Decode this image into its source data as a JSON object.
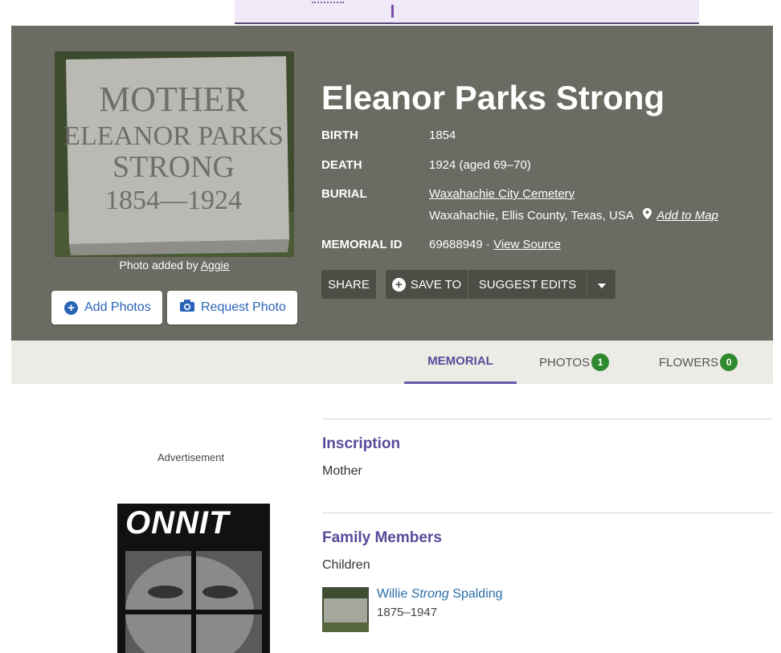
{
  "memorial": {
    "name": "Eleanor Parks Strong",
    "photo_credit_prefix": "Photo added by",
    "photo_credit_user": "Aggie",
    "headstone_lines": [
      "MOTHER",
      "ELEANOR PARKS",
      "STRONG",
      "1854—1924"
    ],
    "birth_label": "BIRTH",
    "birth_value": "1854",
    "death_label": "DEATH",
    "death_value": "1924 (aged 69–70)",
    "burial_label": "BURIAL",
    "cemetery": "Waxahachie City Cemetery",
    "location": "Waxahachie, Ellis County, Texas, USA",
    "add_to_map": "Add to Map",
    "memorial_id_label": "MEMORIAL ID",
    "memorial_id": "69688949",
    "id_separator": "·",
    "view_source": "View Source"
  },
  "buttons": {
    "add_photos": "Add Photos",
    "request_photo": "Request Photo",
    "share": "SHARE",
    "save_to": "SAVE TO",
    "suggest_edits": "SUGGEST EDITS",
    "caret_icon": "caret-down-icon"
  },
  "tabs": {
    "memorial": "MEMORIAL",
    "photos": "PHOTOS",
    "photos_count": "1",
    "flowers": "FLOWERS",
    "flowers_count": "0"
  },
  "sidebar": {
    "ad_label": "Advertisement",
    "ad_brand": "ONNIT"
  },
  "content": {
    "inscription_heading": "Inscription",
    "inscription_text": "Mother",
    "family_heading": "Family Members",
    "children_label": "Children",
    "children": [
      {
        "first": "Willie",
        "middle": "Strong",
        "last": "Spalding",
        "dates": "1875–1947"
      }
    ]
  },
  "colors": {
    "hero_bg": "#6b6b63",
    "accent_purple": "#5a4a9a",
    "link_blue": "#2a64b8",
    "badge_green": "#2f8a2f"
  }
}
